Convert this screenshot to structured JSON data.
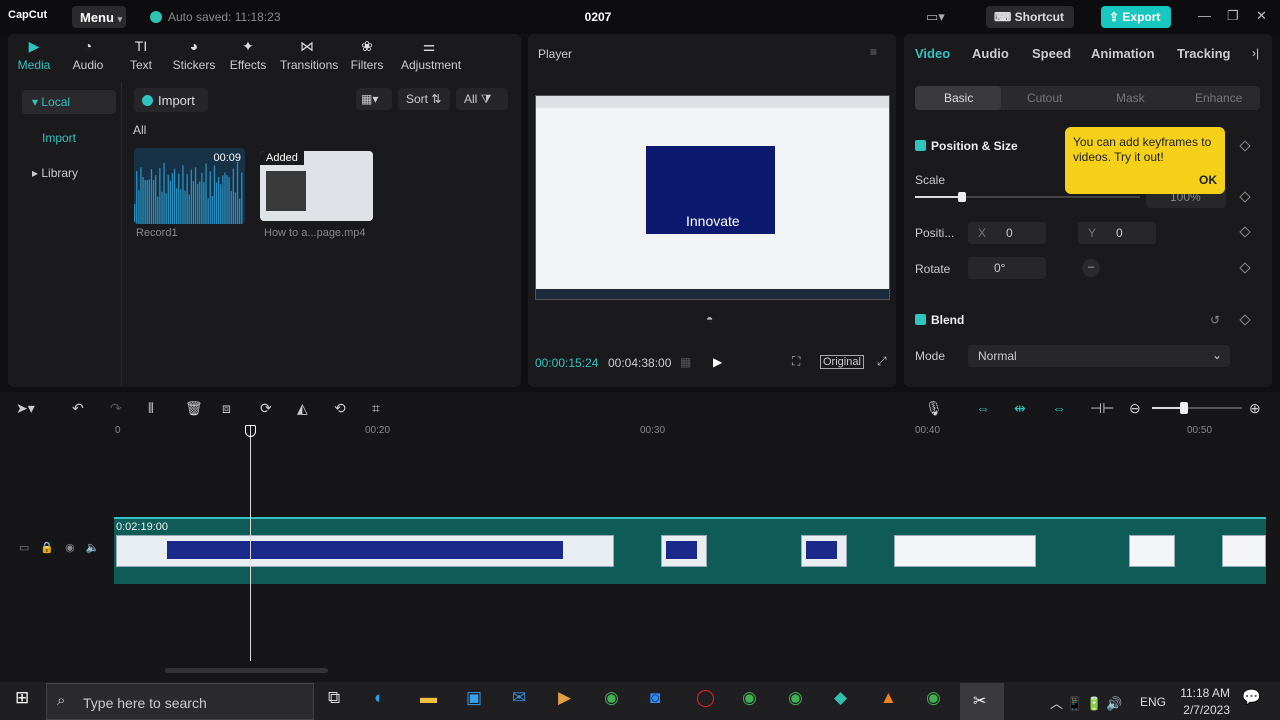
{
  "app": {
    "logo": "CapCut",
    "menu": "Menu",
    "autosave": "Auto saved: 11:18:23",
    "title": "0207",
    "shortcut": "Shortcut",
    "export": "Export"
  },
  "toolbar": [
    {
      "label": "Media",
      "icon": "media-icon"
    },
    {
      "label": "Audio",
      "icon": "audio-icon"
    },
    {
      "label": "Text",
      "icon": "text-icon"
    },
    {
      "label": "Stickers",
      "icon": "stickers-icon"
    },
    {
      "label": "Effects",
      "icon": "effects-icon"
    },
    {
      "label": "Transitions",
      "icon": "transitions-icon"
    },
    {
      "label": "Filters",
      "icon": "filters-icon"
    },
    {
      "label": "Adjustment",
      "icon": "adjustment-icon"
    }
  ],
  "side": {
    "local": "Local",
    "import": "Import",
    "library": "Library"
  },
  "media": {
    "import": "Import",
    "sort": "Sort",
    "all_filter": "All",
    "all_heading": "All",
    "items": [
      {
        "name": "Record1",
        "duration": "00:09"
      },
      {
        "name": "How to a...page.mp4",
        "badge": "Added"
      }
    ]
  },
  "player": {
    "title": "Player",
    "current": "00:00:15:24",
    "total": "00:04:38:00",
    "original": "Original",
    "preview_text": "Innovate"
  },
  "right": {
    "tabs": [
      "Video",
      "Audio",
      "Speed",
      "Animation",
      "Tracking"
    ],
    "subtabs": [
      "Basic",
      "Cutout",
      "Mask",
      "Enhance"
    ],
    "pos_size": "Position & Size",
    "scale": "Scale",
    "scale_value": "100%",
    "position": "Positi...",
    "x_label": "X",
    "x_value": "0",
    "y_label": "Y",
    "y_value": "0",
    "rotate": "Rotate",
    "rotate_value": "0°",
    "blend": "Blend",
    "mode": "Mode",
    "mode_value": "Normal",
    "tooltip": "You can add keyframes to videos. Try it out!",
    "tooltip_ok": "OK"
  },
  "timeline": {
    "ticks": [
      "0",
      "00:20",
      "00:30",
      "00:40",
      "00:50"
    ],
    "clip_duration": "0:02:19:00"
  },
  "taskbar": {
    "search": "Type here to search",
    "lang": "ENG",
    "time": "11:18 AM",
    "date": "2/7/2023"
  }
}
